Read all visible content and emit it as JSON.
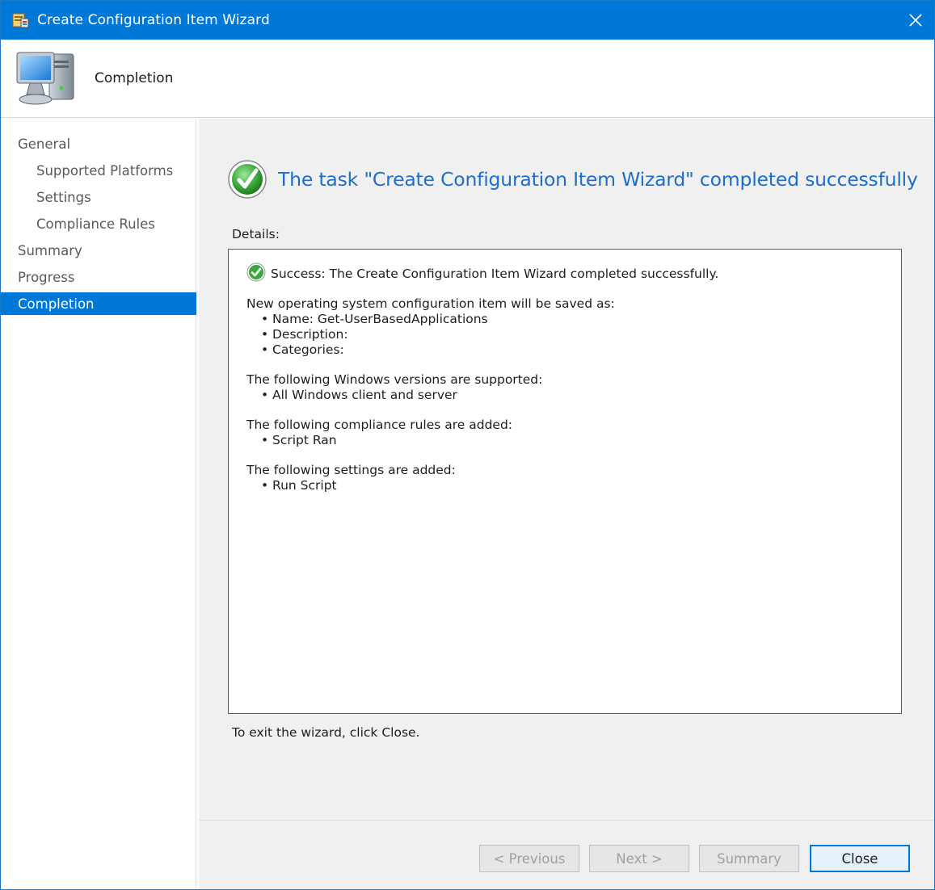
{
  "window": {
    "title": "Create Configuration Item Wizard",
    "title_icon": "wizard-app-icon",
    "close_icon": "close-icon"
  },
  "header": {
    "title": "Completion",
    "icon": "computer-icon"
  },
  "nav": {
    "items": [
      {
        "label": "General",
        "level": 1,
        "active": false
      },
      {
        "label": "Supported Platforms",
        "level": 2,
        "active": false
      },
      {
        "label": "Settings",
        "level": 2,
        "active": false
      },
      {
        "label": "Compliance Rules",
        "level": 2,
        "active": false
      },
      {
        "label": "Summary",
        "level": 1,
        "active": false
      },
      {
        "label": "Progress",
        "level": 1,
        "active": false
      },
      {
        "label": "Completion",
        "level": 1,
        "active": true
      }
    ]
  },
  "main": {
    "success_title": "The task \"Create Configuration Item Wizard\" completed successfully",
    "details_label": "Details:",
    "details": {
      "success_line": "Success: The Create Configuration Item Wizard completed successfully.",
      "item_heading": "New operating system configuration item will be saved as:",
      "item_bullets": [
        "Name: Get-UserBasedApplications",
        "Description:",
        "Categories:"
      ],
      "versions_heading": "The following Windows versions are supported:",
      "versions_bullets": [
        "All Windows client and server"
      ],
      "rules_heading": "The following compliance rules are added:",
      "rules_bullets": [
        "Script Ran"
      ],
      "settings_heading": "The following settings are added:",
      "settings_bullets": [
        "Run Script"
      ]
    },
    "exit_text": "To exit the wizard, click Close."
  },
  "footer": {
    "previous_label": "< Previous",
    "next_label": "Next >",
    "summary_label": "Summary",
    "close_label": "Close"
  },
  "colors": {
    "accent": "#0078d7",
    "title_text": "#1c6fcf",
    "success_green": "#3aa83a"
  }
}
